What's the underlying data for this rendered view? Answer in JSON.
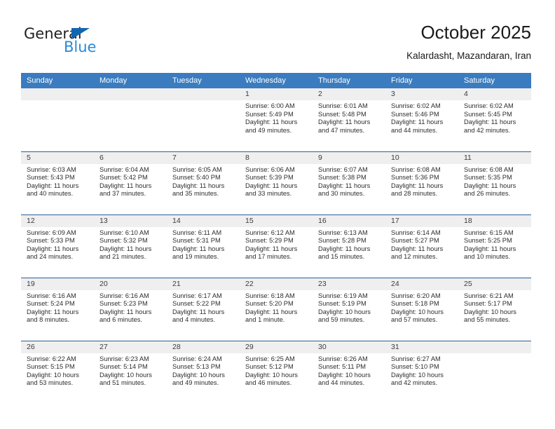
{
  "logo": {
    "word_one": "General",
    "word_two": "Blue",
    "triangle_color": "#1266b0",
    "blue_color": "#2b8ad8"
  },
  "header": {
    "title": "October 2025",
    "subtitle": "Kalardasht, Mazandaran, Iran"
  },
  "theme": {
    "header_blue": "#3a7cbf",
    "row_divider": "#2a6099",
    "daynum_band": "#efefef"
  },
  "weekdays": [
    "Sunday",
    "Monday",
    "Tuesday",
    "Wednesday",
    "Thursday",
    "Friday",
    "Saturday"
  ],
  "labels": {
    "sunrise_prefix": "Sunrise:",
    "sunset_prefix": "Sunset:",
    "daylight_prefix": "Daylight:"
  },
  "weeks": [
    [
      {
        "day": "",
        "empty": true
      },
      {
        "day": "",
        "empty": true
      },
      {
        "day": "",
        "empty": true
      },
      {
        "day": "1",
        "sunrise": "Sunrise: 6:00 AM",
        "sunset": "Sunset: 5:49 PM",
        "daylight_line1": "Daylight: 11 hours",
        "daylight_line2": "and 49 minutes."
      },
      {
        "day": "2",
        "sunrise": "Sunrise: 6:01 AM",
        "sunset": "Sunset: 5:48 PM",
        "daylight_line1": "Daylight: 11 hours",
        "daylight_line2": "and 47 minutes."
      },
      {
        "day": "3",
        "sunrise": "Sunrise: 6:02 AM",
        "sunset": "Sunset: 5:46 PM",
        "daylight_line1": "Daylight: 11 hours",
        "daylight_line2": "and 44 minutes."
      },
      {
        "day": "4",
        "sunrise": "Sunrise: 6:02 AM",
        "sunset": "Sunset: 5:45 PM",
        "daylight_line1": "Daylight: 11 hours",
        "daylight_line2": "and 42 minutes."
      }
    ],
    [
      {
        "day": "5",
        "sunrise": "Sunrise: 6:03 AM",
        "sunset": "Sunset: 5:43 PM",
        "daylight_line1": "Daylight: 11 hours",
        "daylight_line2": "and 40 minutes."
      },
      {
        "day": "6",
        "sunrise": "Sunrise: 6:04 AM",
        "sunset": "Sunset: 5:42 PM",
        "daylight_line1": "Daylight: 11 hours",
        "daylight_line2": "and 37 minutes."
      },
      {
        "day": "7",
        "sunrise": "Sunrise: 6:05 AM",
        "sunset": "Sunset: 5:40 PM",
        "daylight_line1": "Daylight: 11 hours",
        "daylight_line2": "and 35 minutes."
      },
      {
        "day": "8",
        "sunrise": "Sunrise: 6:06 AM",
        "sunset": "Sunset: 5:39 PM",
        "daylight_line1": "Daylight: 11 hours",
        "daylight_line2": "and 33 minutes."
      },
      {
        "day": "9",
        "sunrise": "Sunrise: 6:07 AM",
        "sunset": "Sunset: 5:38 PM",
        "daylight_line1": "Daylight: 11 hours",
        "daylight_line2": "and 30 minutes."
      },
      {
        "day": "10",
        "sunrise": "Sunrise: 6:08 AM",
        "sunset": "Sunset: 5:36 PM",
        "daylight_line1": "Daylight: 11 hours",
        "daylight_line2": "and 28 minutes."
      },
      {
        "day": "11",
        "sunrise": "Sunrise: 6:08 AM",
        "sunset": "Sunset: 5:35 PM",
        "daylight_line1": "Daylight: 11 hours",
        "daylight_line2": "and 26 minutes."
      }
    ],
    [
      {
        "day": "12",
        "sunrise": "Sunrise: 6:09 AM",
        "sunset": "Sunset: 5:33 PM",
        "daylight_line1": "Daylight: 11 hours",
        "daylight_line2": "and 24 minutes."
      },
      {
        "day": "13",
        "sunrise": "Sunrise: 6:10 AM",
        "sunset": "Sunset: 5:32 PM",
        "daylight_line1": "Daylight: 11 hours",
        "daylight_line2": "and 21 minutes."
      },
      {
        "day": "14",
        "sunrise": "Sunrise: 6:11 AM",
        "sunset": "Sunset: 5:31 PM",
        "daylight_line1": "Daylight: 11 hours",
        "daylight_line2": "and 19 minutes."
      },
      {
        "day": "15",
        "sunrise": "Sunrise: 6:12 AM",
        "sunset": "Sunset: 5:29 PM",
        "daylight_line1": "Daylight: 11 hours",
        "daylight_line2": "and 17 minutes."
      },
      {
        "day": "16",
        "sunrise": "Sunrise: 6:13 AM",
        "sunset": "Sunset: 5:28 PM",
        "daylight_line1": "Daylight: 11 hours",
        "daylight_line2": "and 15 minutes."
      },
      {
        "day": "17",
        "sunrise": "Sunrise: 6:14 AM",
        "sunset": "Sunset: 5:27 PM",
        "daylight_line1": "Daylight: 11 hours",
        "daylight_line2": "and 12 minutes."
      },
      {
        "day": "18",
        "sunrise": "Sunrise: 6:15 AM",
        "sunset": "Sunset: 5:25 PM",
        "daylight_line1": "Daylight: 11 hours",
        "daylight_line2": "and 10 minutes."
      }
    ],
    [
      {
        "day": "19",
        "sunrise": "Sunrise: 6:16 AM",
        "sunset": "Sunset: 5:24 PM",
        "daylight_line1": "Daylight: 11 hours",
        "daylight_line2": "and 8 minutes."
      },
      {
        "day": "20",
        "sunrise": "Sunrise: 6:16 AM",
        "sunset": "Sunset: 5:23 PM",
        "daylight_line1": "Daylight: 11 hours",
        "daylight_line2": "and 6 minutes."
      },
      {
        "day": "21",
        "sunrise": "Sunrise: 6:17 AM",
        "sunset": "Sunset: 5:22 PM",
        "daylight_line1": "Daylight: 11 hours",
        "daylight_line2": "and 4 minutes."
      },
      {
        "day": "22",
        "sunrise": "Sunrise: 6:18 AM",
        "sunset": "Sunset: 5:20 PM",
        "daylight_line1": "Daylight: 11 hours",
        "daylight_line2": "and 1 minute."
      },
      {
        "day": "23",
        "sunrise": "Sunrise: 6:19 AM",
        "sunset": "Sunset: 5:19 PM",
        "daylight_line1": "Daylight: 10 hours",
        "daylight_line2": "and 59 minutes."
      },
      {
        "day": "24",
        "sunrise": "Sunrise: 6:20 AM",
        "sunset": "Sunset: 5:18 PM",
        "daylight_line1": "Daylight: 10 hours",
        "daylight_line2": "and 57 minutes."
      },
      {
        "day": "25",
        "sunrise": "Sunrise: 6:21 AM",
        "sunset": "Sunset: 5:17 PM",
        "daylight_line1": "Daylight: 10 hours",
        "daylight_line2": "and 55 minutes."
      }
    ],
    [
      {
        "day": "26",
        "sunrise": "Sunrise: 6:22 AM",
        "sunset": "Sunset: 5:15 PM",
        "daylight_line1": "Daylight: 10 hours",
        "daylight_line2": "and 53 minutes."
      },
      {
        "day": "27",
        "sunrise": "Sunrise: 6:23 AM",
        "sunset": "Sunset: 5:14 PM",
        "daylight_line1": "Daylight: 10 hours",
        "daylight_line2": "and 51 minutes."
      },
      {
        "day": "28",
        "sunrise": "Sunrise: 6:24 AM",
        "sunset": "Sunset: 5:13 PM",
        "daylight_line1": "Daylight: 10 hours",
        "daylight_line2": "and 49 minutes."
      },
      {
        "day": "29",
        "sunrise": "Sunrise: 6:25 AM",
        "sunset": "Sunset: 5:12 PM",
        "daylight_line1": "Daylight: 10 hours",
        "daylight_line2": "and 46 minutes."
      },
      {
        "day": "30",
        "sunrise": "Sunrise: 6:26 AM",
        "sunset": "Sunset: 5:11 PM",
        "daylight_line1": "Daylight: 10 hours",
        "daylight_line2": "and 44 minutes."
      },
      {
        "day": "31",
        "sunrise": "Sunrise: 6:27 AM",
        "sunset": "Sunset: 5:10 PM",
        "daylight_line1": "Daylight: 10 hours",
        "daylight_line2": "and 42 minutes."
      },
      {
        "day": "",
        "empty": true
      }
    ]
  ]
}
